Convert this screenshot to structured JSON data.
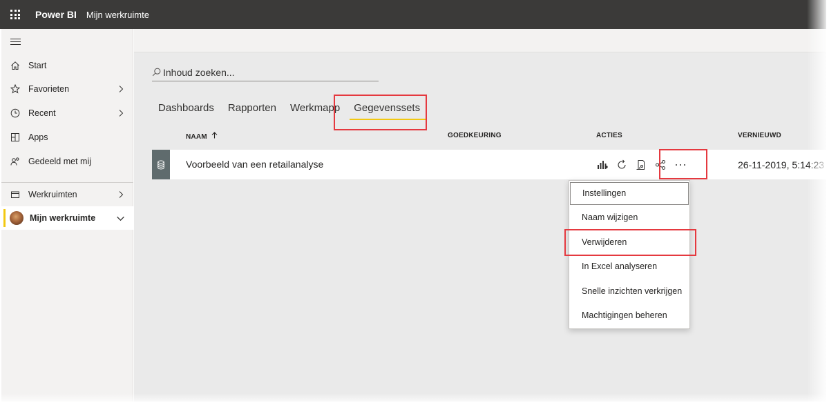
{
  "app": {
    "brand": "Power BI",
    "workspace_crumb": "Mijn werkruimte"
  },
  "sidebar": {
    "items": [
      {
        "label": "Start",
        "icon": "home-icon"
      },
      {
        "label": "Favorieten",
        "icon": "star-icon"
      },
      {
        "label": "Recent",
        "icon": "clock-icon"
      },
      {
        "label": "Apps",
        "icon": "apps-icon"
      },
      {
        "label": "Gedeeld met mij",
        "icon": "shared-people-icon"
      },
      {
        "label": "Werkruimten",
        "icon": "workspaces-icon"
      },
      {
        "label": "Mijn werkruimte",
        "icon": "avatar"
      }
    ]
  },
  "search": {
    "placeholder": "Inhoud zoeken..."
  },
  "tabs": [
    {
      "label": "Dashboards"
    },
    {
      "label": "Rapporten"
    },
    {
      "label": "Werkmapp"
    },
    {
      "label": "Gegevenssets",
      "selected": true
    }
  ],
  "table": {
    "headers": {
      "name": "NAAM",
      "endorsement": "GOEDKEURING",
      "actions": "ACTIES",
      "refreshed": "VERNIEUWD"
    },
    "rows": [
      {
        "name": "Voorbeeld van een retailanalyse",
        "refreshed": "26-11-2019, 5:14:23"
      }
    ]
  },
  "context_menu": {
    "items": [
      {
        "label": "Instellingen"
      },
      {
        "label": "Naam wijzigen"
      },
      {
        "label": "Verwijderen"
      },
      {
        "label": "In Excel analyseren"
      },
      {
        "label": "Snelle inzichten verkrijgen"
      },
      {
        "label": "Machtigingen beheren"
      }
    ]
  },
  "colors": {
    "topbar": "#3b3a39",
    "accent_yellow": "#f2c811",
    "highlight_red": "#e5393f",
    "dataset_tile": "#5f6b6d"
  }
}
